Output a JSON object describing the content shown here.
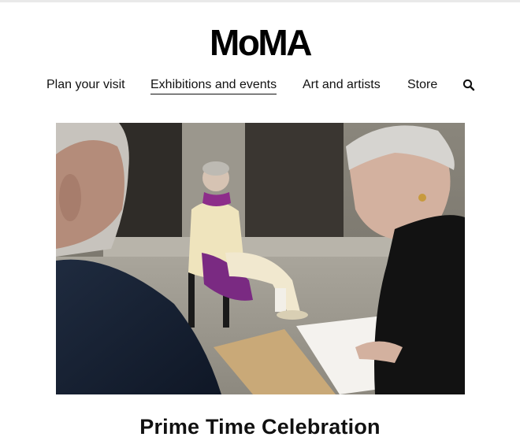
{
  "brand": {
    "logo_text": "MoMA"
  },
  "nav": {
    "items": [
      {
        "label": "Plan your visit",
        "active": false
      },
      {
        "label": "Exhibitions and events",
        "active": true
      },
      {
        "label": "Art and artists",
        "active": false
      },
      {
        "label": "Store",
        "active": false
      }
    ],
    "search_icon": "search-icon"
  },
  "hero": {
    "headline": "Prime Time Celebration"
  }
}
